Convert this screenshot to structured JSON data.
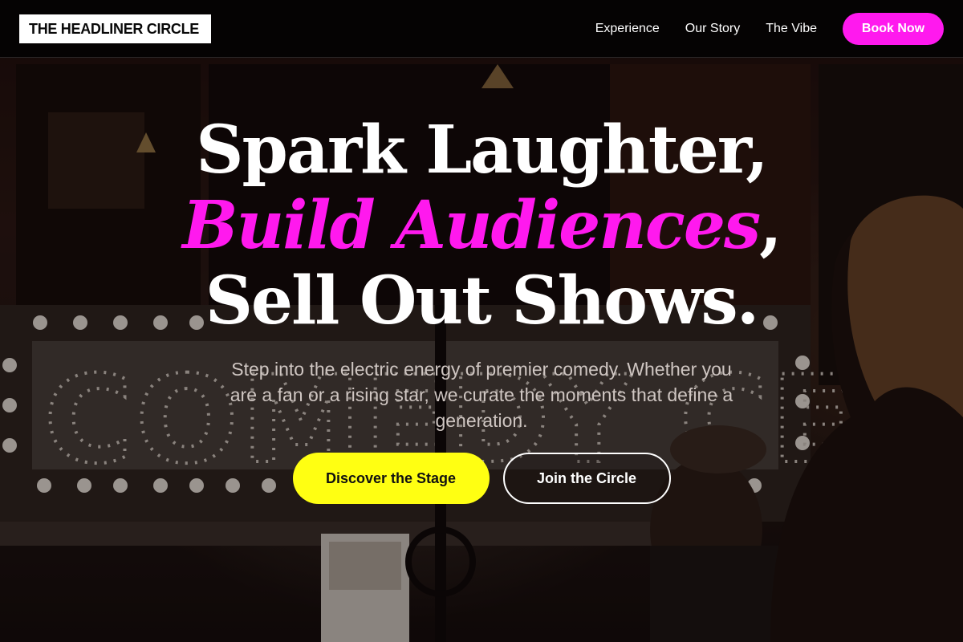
{
  "header": {
    "logo": "THE HEADLINER CIRCLE",
    "nav": [
      {
        "label": "Experience"
      },
      {
        "label": "Our Story"
      },
      {
        "label": "The Vibe"
      }
    ],
    "cta_label": "Book Now"
  },
  "hero": {
    "headline_line1": "Spark Laughter,",
    "headline_accent": "Build Audiences",
    "headline_comma": ",",
    "headline_line3": "Sell Out Shows.",
    "subtext": "Step into the electric energy of premier comedy. Whether you are a fan or a rising star, we curate the moments that define a generation.",
    "primary_cta": "Discover the Stage",
    "secondary_cta": "Join the Circle",
    "background_sign_text": "COMEDY CELLAR"
  },
  "colors": {
    "accent_magenta": "#ff19ee",
    "primary_yellow": "#ffff12",
    "header_bg": "#050303",
    "text_white": "#ffffff"
  }
}
